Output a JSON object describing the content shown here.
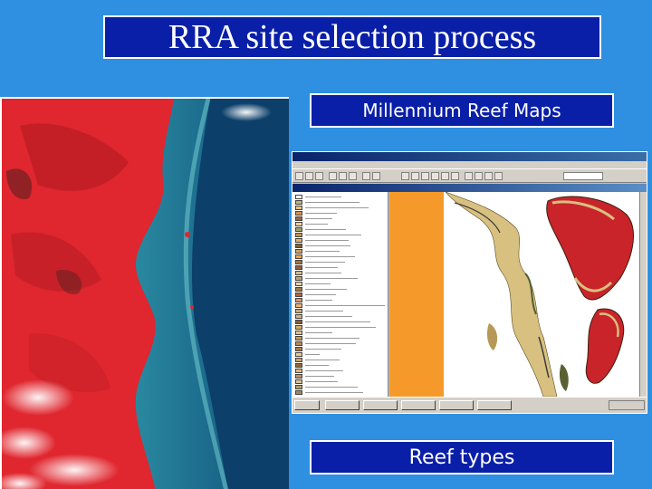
{
  "slide": {
    "title": "RRA site selection process",
    "label_top": "Millennium Reef Maps",
    "label_bottom": "Reef types"
  },
  "colors": {
    "background": "#2f8fe0",
    "label_fill": "#0a1fa8",
    "label_border": "#ffffff",
    "land_red": "#e0262e",
    "lagoon_teal": "#2a8aa0",
    "deep_sea": "#0d4a78",
    "map_orange": "#f59a2a",
    "map_red": "#c8242a",
    "map_tan": "#c8b070"
  },
  "icons": [
    "satellite-image",
    "gis-application-window",
    "reef-map"
  ]
}
